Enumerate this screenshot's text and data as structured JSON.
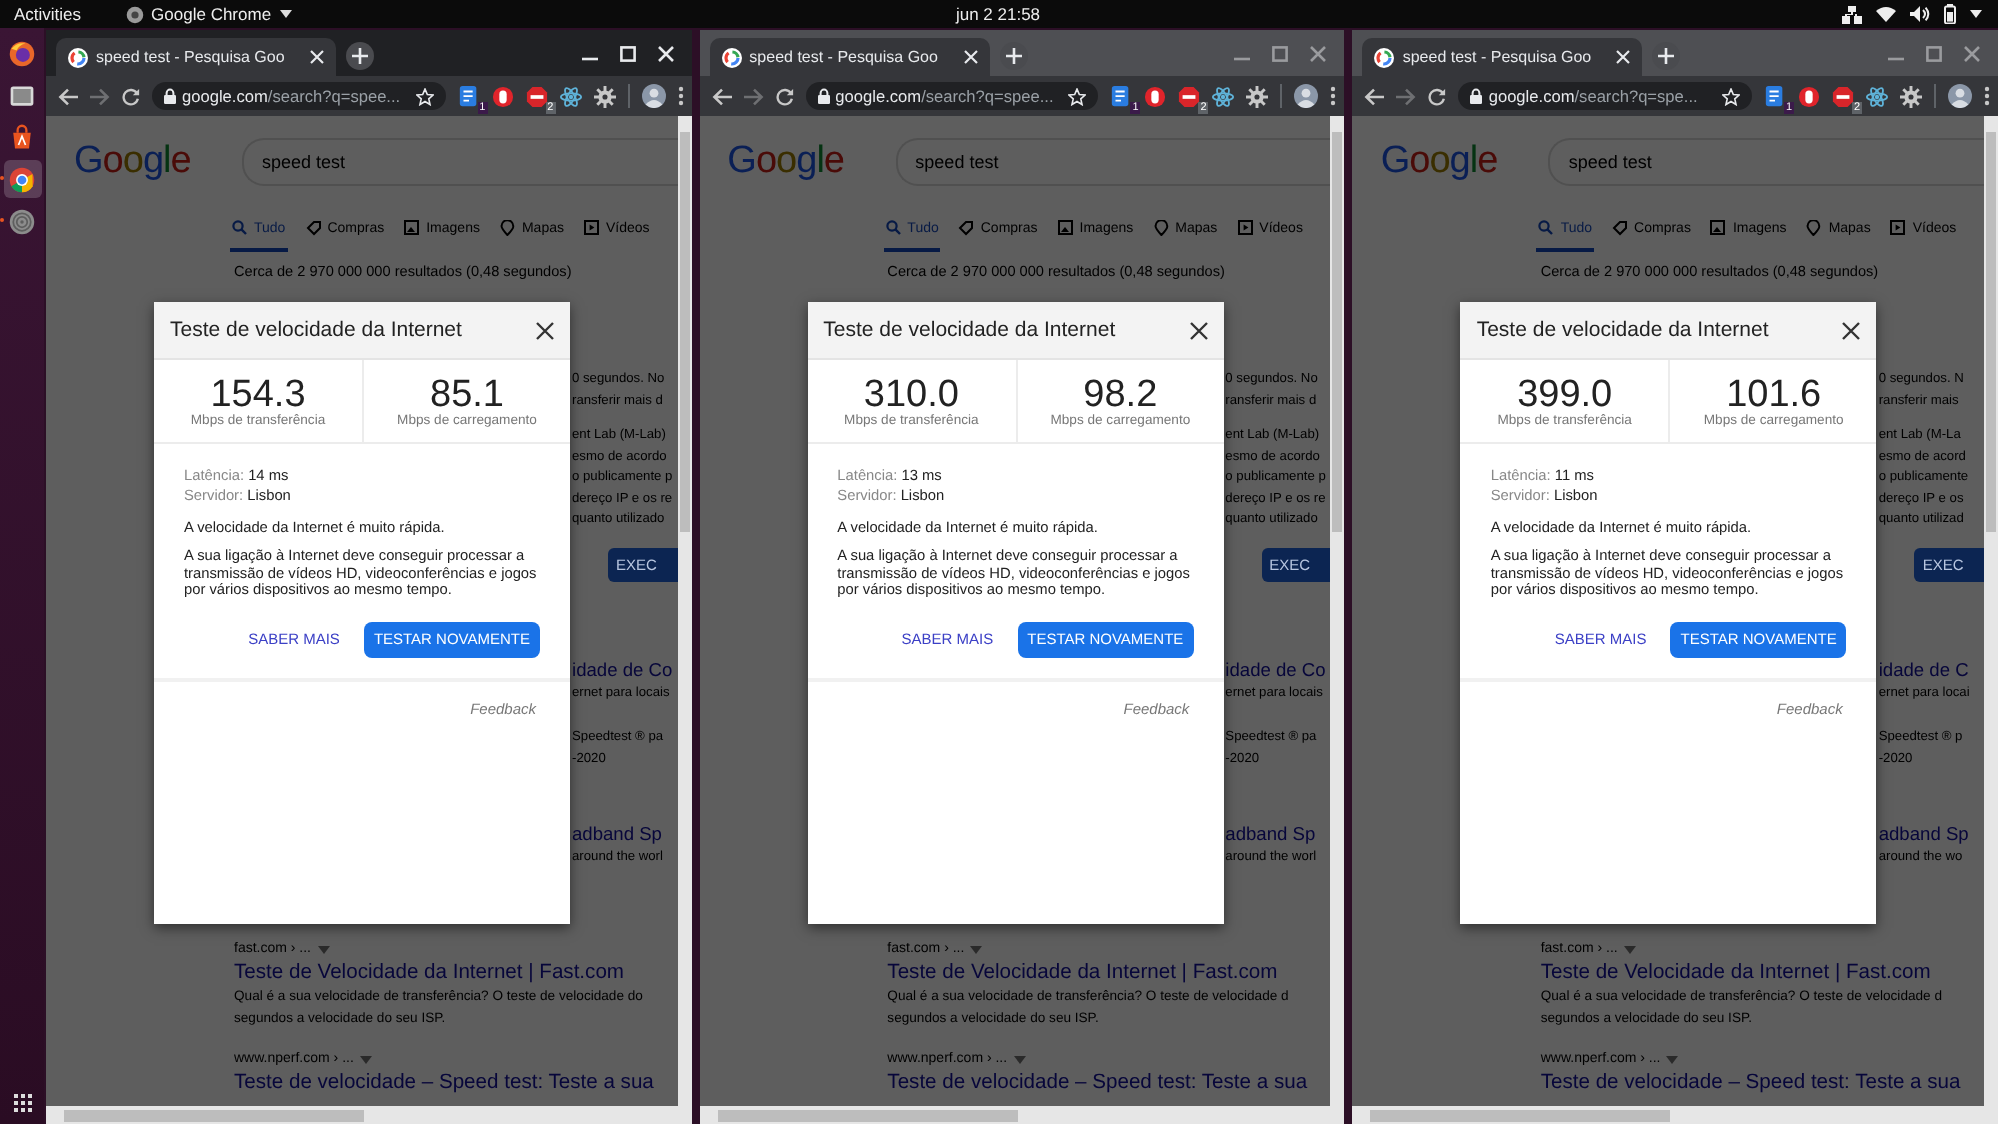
{
  "top_bar": {
    "activities": "Activities",
    "app_name": "Google Chrome",
    "clock": "jun 2  21:58"
  },
  "dock": [
    {
      "kind": "firefox",
      "selected": false,
      "running": false
    },
    {
      "kind": "files",
      "selected": false,
      "running": false
    },
    {
      "kind": "software",
      "selected": false,
      "running": false
    },
    {
      "kind": "chrome",
      "selected": true,
      "running": true
    },
    {
      "kind": "disc",
      "selected": false,
      "running": true
    }
  ],
  "windows": [
    {
      "focused": true,
      "tab_title": "speed test - Pesquisa Goo",
      "url_domain": "google.com",
      "url_path": "/search?q=spee...",
      "extensions": [
        {
          "kind": "note",
          "badge": "1"
        },
        {
          "kind": "record"
        },
        {
          "kind": "stop",
          "badge": "2"
        },
        {
          "kind": "atom"
        },
        {
          "kind": "gear"
        }
      ],
      "logo": "Google",
      "query": "speed test",
      "nav_tabs": [
        {
          "label": "Tudo",
          "selected": true
        },
        {
          "label": "Compras",
          "selected": false
        },
        {
          "label": "Imagens",
          "selected": false
        },
        {
          "label": "Mapas",
          "selected": false
        },
        {
          "label": "Vídeos",
          "selected": false
        }
      ],
      "result_count": "Cerca de 2 970 000 000 resultados (0,48 segundos)",
      "side_blocks": [
        {
          "kind": "snippet",
          "lines": [
            "0 segundos. No",
            "ransferir mais d"
          ]
        },
        {
          "kind": "snippet",
          "lines": [
            "ent Lab (M-Lab)",
            "esmo de acordo",
            "o publicamente p",
            "dereço IP e os re",
            "quanto utilizado"
          ]
        },
        {
          "kind": "button",
          "label": "EXEC"
        },
        {
          "kind": "result",
          "title": "idade de Co",
          "lines": [
            "ernet para locais"
          ]
        },
        {
          "kind": "snippet",
          "lines": [
            "Speedtest ® pa",
            "-2020"
          ]
        },
        {
          "kind": "result",
          "title": "adband Sp",
          "lines": [
            "around the worl"
          ]
        }
      ],
      "results": [
        {
          "kind": "url",
          "text": "fast.com › ..."
        },
        {
          "kind": "title",
          "text": "Teste de Velocidade da Internet | Fast.com"
        },
        {
          "kind": "snippet",
          "text": "Qual é a sua velocidade de transferência? O teste de velocidade do"
        },
        {
          "kind": "snippet",
          "text": "segundos a velocidade do seu ISP."
        },
        {
          "kind": "url",
          "text": "www.nperf.com › ..."
        },
        {
          "kind": "title",
          "text": "Teste de velocidade – Speed test: Teste a sua"
        }
      ],
      "dialog": {
        "title": "Teste de velocidade da Internet",
        "download": "154.3",
        "download_label": "Mbps de transferência",
        "upload": "85.1",
        "upload_label": "Mbps de carregamento",
        "latency_label": "Latência:",
        "latency": "14 ms",
        "server_label": "Servidor:",
        "server": "Lisbon",
        "verdict": "A velocidade da Internet é muito rápida.",
        "description": "A sua ligação à Internet deve conseguir processar a transmissão de vídeos HD, videoconferências e jogos por vários dispositivos ao mesmo tempo.",
        "learn_more": "SABER MAIS",
        "retest": "TESTAR NOVAMENTE",
        "feedback": "Feedback"
      }
    },
    {
      "focused": false,
      "tab_title": "speed test - Pesquisa Goo",
      "url_domain": "google.com",
      "url_path": "/search?q=spee...",
      "extensions": [
        {
          "kind": "note",
          "badge": "1"
        },
        {
          "kind": "record"
        },
        {
          "kind": "stop",
          "badge": "2"
        },
        {
          "kind": "atom"
        },
        {
          "kind": "gear"
        }
      ],
      "logo": "Google",
      "query": "speed test",
      "nav_tabs": [
        {
          "label": "Tudo",
          "selected": true
        },
        {
          "label": "Compras",
          "selected": false
        },
        {
          "label": "Imagens",
          "selected": false
        },
        {
          "label": "Mapas",
          "selected": false
        },
        {
          "label": "Vídeos",
          "selected": false
        }
      ],
      "result_count": "Cerca de 2 970 000 000 resultados (0,48 segundos)",
      "side_blocks": [
        {
          "kind": "snippet",
          "lines": [
            "0 segundos. No",
            "ransferir mais d"
          ]
        },
        {
          "kind": "snippet",
          "lines": [
            "ent Lab (M-Lab)",
            "esmo de acordo",
            "o publicamente p",
            "dereço IP e os re",
            "quanto utilizado"
          ]
        },
        {
          "kind": "button",
          "label": "EXEC"
        },
        {
          "kind": "result",
          "title": "idade de Co",
          "lines": [
            "ernet para locais"
          ]
        },
        {
          "kind": "snippet",
          "lines": [
            "Speedtest ® pa",
            "-2020"
          ]
        },
        {
          "kind": "result",
          "title": "adband Sp",
          "lines": [
            "around the worl"
          ]
        }
      ],
      "results": [
        {
          "kind": "url",
          "text": "fast.com › ..."
        },
        {
          "kind": "title",
          "text": "Teste de Velocidade da Internet | Fast.com"
        },
        {
          "kind": "snippet",
          "text": "Qual é a sua velocidade de transferência? O teste de velocidade d"
        },
        {
          "kind": "snippet",
          "text": "segundos a velocidade do seu ISP."
        },
        {
          "kind": "url",
          "text": "www.nperf.com › ..."
        },
        {
          "kind": "title",
          "text": "Teste de velocidade – Speed test: Teste a sua"
        }
      ],
      "dialog": {
        "title": "Teste de velocidade da Internet",
        "download": "310.0",
        "download_label": "Mbps de transferência",
        "upload": "98.2",
        "upload_label": "Mbps de carregamento",
        "latency_label": "Latência:",
        "latency": "13 ms",
        "server_label": "Servidor:",
        "server": "Lisbon",
        "verdict": "A velocidade da Internet é muito rápida.",
        "description": "A sua ligação à Internet deve conseguir processar a transmissão de vídeos HD, videoconferências e jogos por vários dispositivos ao mesmo tempo.",
        "learn_more": "SABER MAIS",
        "retest": "TESTAR NOVAMENTE",
        "feedback": "Feedback"
      }
    },
    {
      "focused": false,
      "tab_title": "speed test - Pesquisa Goo",
      "url_domain": "google.com",
      "url_path": "/search?q=spe...",
      "extensions": [
        {
          "kind": "note",
          "badge": "1"
        },
        {
          "kind": "record"
        },
        {
          "kind": "stop",
          "badge": "2"
        },
        {
          "kind": "atom"
        },
        {
          "kind": "gear"
        }
      ],
      "logo": "Google",
      "query": "speed test",
      "nav_tabs": [
        {
          "label": "Tudo",
          "selected": true
        },
        {
          "label": "Compras",
          "selected": false
        },
        {
          "label": "Imagens",
          "selected": false
        },
        {
          "label": "Mapas",
          "selected": false
        },
        {
          "label": "Vídeos",
          "selected": false
        }
      ],
      "result_count": "Cerca de 2 970 000 000 resultados (0,48 segundos)",
      "side_blocks": [
        {
          "kind": "snippet",
          "lines": [
            "0 segundos. N",
            "ransferir mais"
          ]
        },
        {
          "kind": "snippet",
          "lines": [
            "ent Lab (M-La",
            "esmo de acord",
            "o publicamente",
            "dereço IP e os",
            "quanto utilizad"
          ]
        },
        {
          "kind": "button",
          "label": "EXEC"
        },
        {
          "kind": "result",
          "title": "idade de C",
          "lines": [
            "ernet para locai"
          ]
        },
        {
          "kind": "snippet",
          "lines": [
            "Speedtest ® p",
            "-2020"
          ]
        },
        {
          "kind": "result",
          "title": "adband Sp",
          "lines": [
            "around the wo"
          ]
        }
      ],
      "results": [
        {
          "kind": "url",
          "text": "fast.com › ..."
        },
        {
          "kind": "title",
          "text": "Teste de Velocidade da Internet | Fast.com"
        },
        {
          "kind": "snippet",
          "text": "Qual é a sua velocidade de transferência? O teste de velocidade d"
        },
        {
          "kind": "snippet",
          "text": "segundos a velocidade do seu ISP."
        },
        {
          "kind": "url",
          "text": "www.nperf.com › ..."
        },
        {
          "kind": "title",
          "text": "Teste de velocidade – Speed test: Teste a sua"
        }
      ],
      "dialog": {
        "title": "Teste de velocidade da Internet",
        "download": "399.0",
        "download_label": "Mbps de transferência",
        "upload": "101.6",
        "upload_label": "Mbps de carregamento",
        "latency_label": "Latência:",
        "latency": "11 ms",
        "server_label": "Servidor:",
        "server": "Lisbon",
        "verdict": "A velocidade da Internet é muito rápida.",
        "description": "A sua ligação à Internet deve conseguir processar a transmissão de vídeos HD, videoconferências e jogos por vários dispositivos ao mesmo tempo.",
        "learn_more": "SABER MAIS",
        "retest": "TESTAR NOVAMENTE",
        "feedback": "Feedback"
      }
    }
  ]
}
